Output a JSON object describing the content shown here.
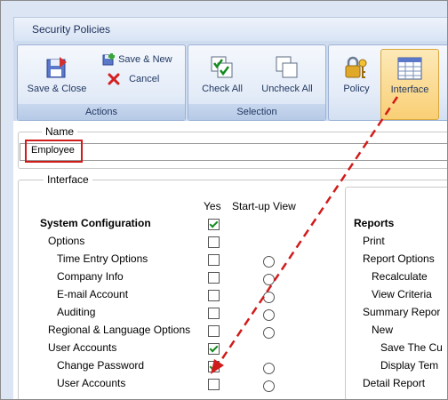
{
  "window": {
    "title": "Security Policies"
  },
  "ribbon": {
    "actions": {
      "label": "Actions",
      "save_close": "Save & Close",
      "save_new": "Save & New",
      "cancel": "Cancel"
    },
    "selection": {
      "label": "Selection",
      "check_all": "Check All",
      "uncheck_all": "Uncheck All"
    },
    "policy": "Policy",
    "interface": "Interface"
  },
  "name_section": {
    "legend": "Name",
    "value": "Employee"
  },
  "interface_section": {
    "legend": "Interface",
    "col_yes": "Yes",
    "col_startup": "Start-up View",
    "rows": [
      {
        "label": "System Configuration",
        "yes": true,
        "radio": false
      },
      {
        "label": "Options",
        "yes": false,
        "radio": false
      },
      {
        "label": "Time Entry Options",
        "yes": false,
        "radio": true
      },
      {
        "label": "Company Info",
        "yes": false,
        "radio": true
      },
      {
        "label": "E-mail Account",
        "yes": false,
        "radio": true
      },
      {
        "label": "Auditing",
        "yes": false,
        "radio": true
      },
      {
        "label": "Regional & Language Options",
        "yes": false,
        "radio": true
      },
      {
        "label": "User Accounts",
        "yes": true,
        "radio": false
      },
      {
        "label": "Change Password",
        "yes": true,
        "radio": true
      },
      {
        "label": "User Accounts",
        "yes": false,
        "radio": true
      }
    ]
  },
  "reports_section": {
    "rows": [
      "Reports",
      "Print",
      "Report Options",
      "Recalculate",
      "View Criteria",
      "Summary Repor",
      "New",
      "Save The Cu",
      "Display Tem",
      "Detail Report"
    ]
  },
  "colors": {
    "highlight": "#d11b1b",
    "check": "#138a1e",
    "ribbon_text": "#1e355f"
  }
}
